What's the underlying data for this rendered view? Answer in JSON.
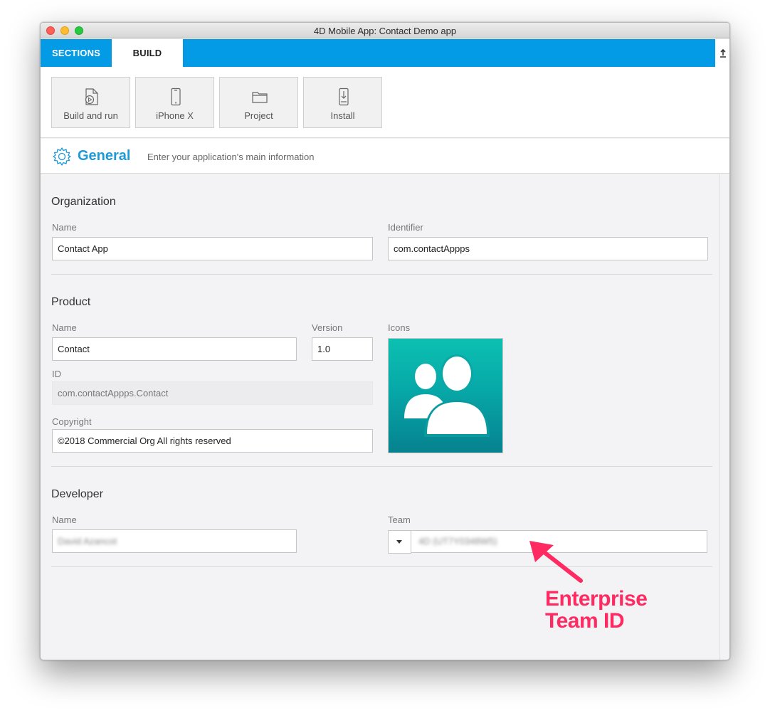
{
  "window": {
    "title": "4D Mobile App: Contact Demo app"
  },
  "tabs": {
    "sections": "SECTIONS",
    "build": "BUILD"
  },
  "toolbar": {
    "buttons": [
      {
        "label": "Build and run",
        "icon": "build-run-icon"
      },
      {
        "label": "iPhone X",
        "icon": "iphone-icon"
      },
      {
        "label": "Project",
        "icon": "folder-icon"
      },
      {
        "label": "Install",
        "icon": "install-icon"
      }
    ]
  },
  "header": {
    "title": "General",
    "subtitle": "Enter your application's main information"
  },
  "organization": {
    "title": "Organization",
    "name_label": "Name",
    "name_value": "Contact App",
    "identifier_label": "Identifier",
    "identifier_value": "com.contactAppps"
  },
  "product": {
    "title": "Product",
    "name_label": "Name",
    "name_value": "Contact",
    "version_label": "Version",
    "version_value": "1.0",
    "icons_label": "Icons",
    "id_label": "ID",
    "id_value": "com.contactAppps.Contact",
    "copyright_label": "Copyright",
    "copyright_value": "©2018 Commercial Org All rights reserved"
  },
  "developer": {
    "title": "Developer",
    "name_label": "Name",
    "name_value": "David Azancot",
    "team_label": "Team",
    "team_value": "4D (UT7Y0348W5)"
  },
  "annotation": {
    "line1": "Enterprise",
    "line2": "Team ID",
    "color": "#fe2a61"
  },
  "colors": {
    "accent": "#039be5",
    "title_blue": "#1e9ad6"
  }
}
